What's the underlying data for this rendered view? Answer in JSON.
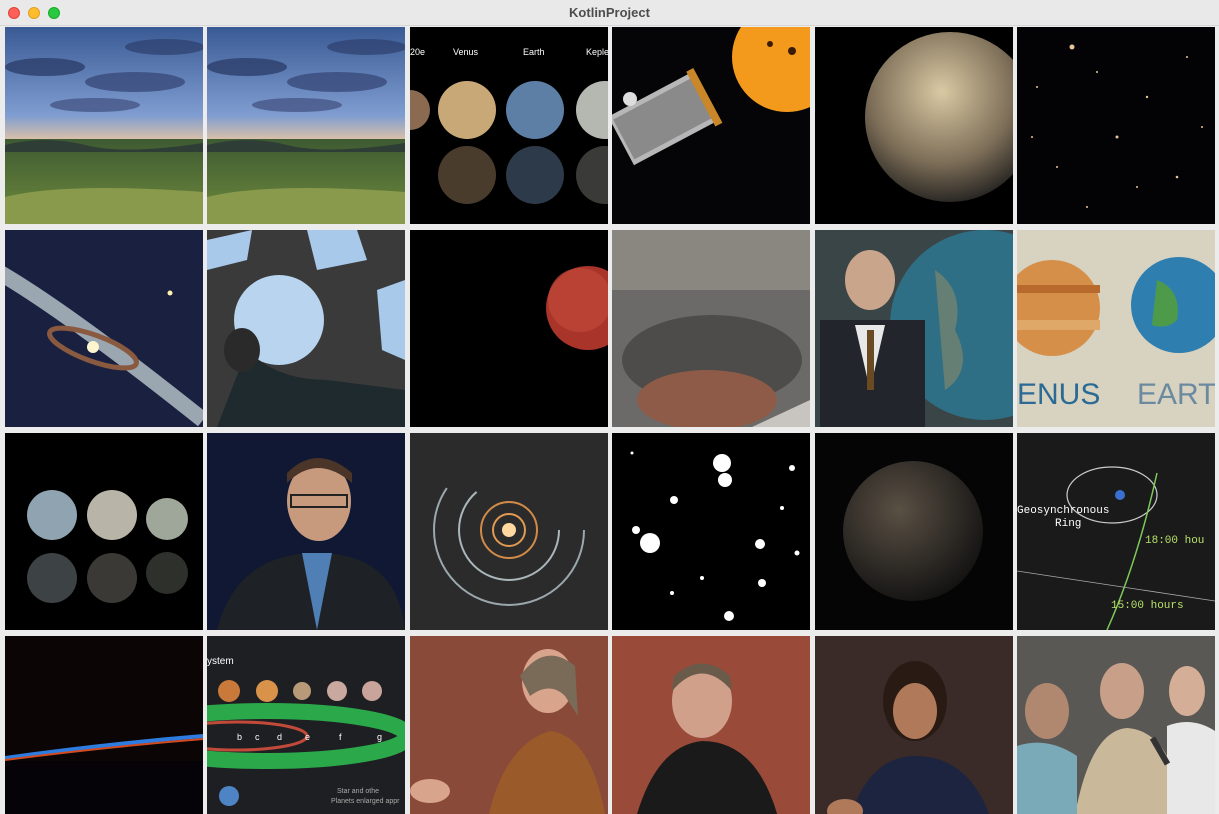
{
  "window": {
    "title": "KotlinProject"
  },
  "gallery": {
    "tiles": [
      {
        "label": "landscape-sunset-photo"
      },
      {
        "label": "landscape-sunset-photo-duplicate"
      },
      {
        "label": "planet-lineup-photo",
        "captions": [
          "20e",
          "Venus",
          "Earth",
          "Keple"
        ]
      },
      {
        "label": "kepler-telescope-star-photo"
      },
      {
        "label": "rocky-exoplanet-photo"
      },
      {
        "label": "deep-field-galaxies-photo"
      },
      {
        "label": "debris-disk-illustration"
      },
      {
        "label": "cupola-astronaut-photo"
      },
      {
        "label": "red-planet-photo"
      },
      {
        "label": "crater-surface-photo"
      },
      {
        "label": "presenter-with-globe-photo"
      },
      {
        "label": "venus-earth-illustration",
        "captions": [
          "ENUS",
          "EART"
        ]
      },
      {
        "label": "exoplanet-lineup-photo"
      },
      {
        "label": "scientist-interview-photo"
      },
      {
        "label": "spiral-orbit-illustration"
      },
      {
        "label": "star-field-negative-photo"
      },
      {
        "label": "dark-planet-photo"
      },
      {
        "label": "geosynchronous-diagram",
        "captions": [
          "Geosynchronous",
          "Ring",
          "18:00 hou",
          "15:00 hours"
        ]
      },
      {
        "label": "earth-horizon-night-photo"
      },
      {
        "label": "trappist-system-illustration",
        "captions": [
          "ystem",
          "b",
          "c",
          "d",
          "e",
          "f",
          "g",
          "Star and othe",
          "Planets enlarged appr"
        ]
      },
      {
        "label": "panelist-woman-photo"
      },
      {
        "label": "panelist-man-photo"
      },
      {
        "label": "panelist-woman-two-photo"
      },
      {
        "label": "panel-group-photo"
      }
    ]
  }
}
